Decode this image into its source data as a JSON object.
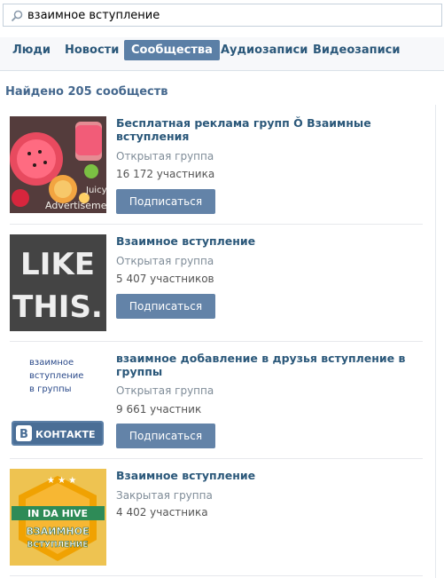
{
  "search": {
    "value": "взаимное вступление"
  },
  "tabs": [
    {
      "label": "Люди",
      "active": false
    },
    {
      "label": "Новости",
      "active": false
    },
    {
      "label": "Сообщества",
      "active": true
    },
    {
      "label": "Аудиозаписи",
      "active": false
    },
    {
      "label": "Видеозаписи",
      "active": false
    }
  ],
  "found_text": "Найдено 205 сообществ",
  "groups": [
    {
      "title": "Бесплатная реклама групп Ǒ Взаимные вступления",
      "type": "Открытая группа",
      "members": "16 172 участника",
      "button": "Подписаться",
      "thumb_text": [
        "Juicy",
        "Advertisement"
      ]
    },
    {
      "title": "Взаимное вступление",
      "type": "Открытая группа",
      "members": "5 407 участников",
      "button": "Подписаться",
      "thumb_text": [
        "LIKE",
        "THIS."
      ]
    },
    {
      "title": "взаимное добавление в друзья вступление в группы",
      "type": "Открытая группа",
      "members": "9 661 участник",
      "button": "Подписаться",
      "thumb_text": [
        "взаимное",
        "вступление",
        "в группы",
        "В",
        "КОНТАКТЕ"
      ]
    },
    {
      "title": "Взаимное вступление",
      "type": "Закрытая группа",
      "members": "4 402 участника",
      "thumb_text": [
        "IN DA HIVE",
        "ВЗАИМНОЕ",
        "ВСТУПЛЕНИЕ"
      ]
    }
  ],
  "colors": {
    "accent": "#5b7fa6",
    "link": "#2b587a",
    "button": "#6383a8"
  }
}
